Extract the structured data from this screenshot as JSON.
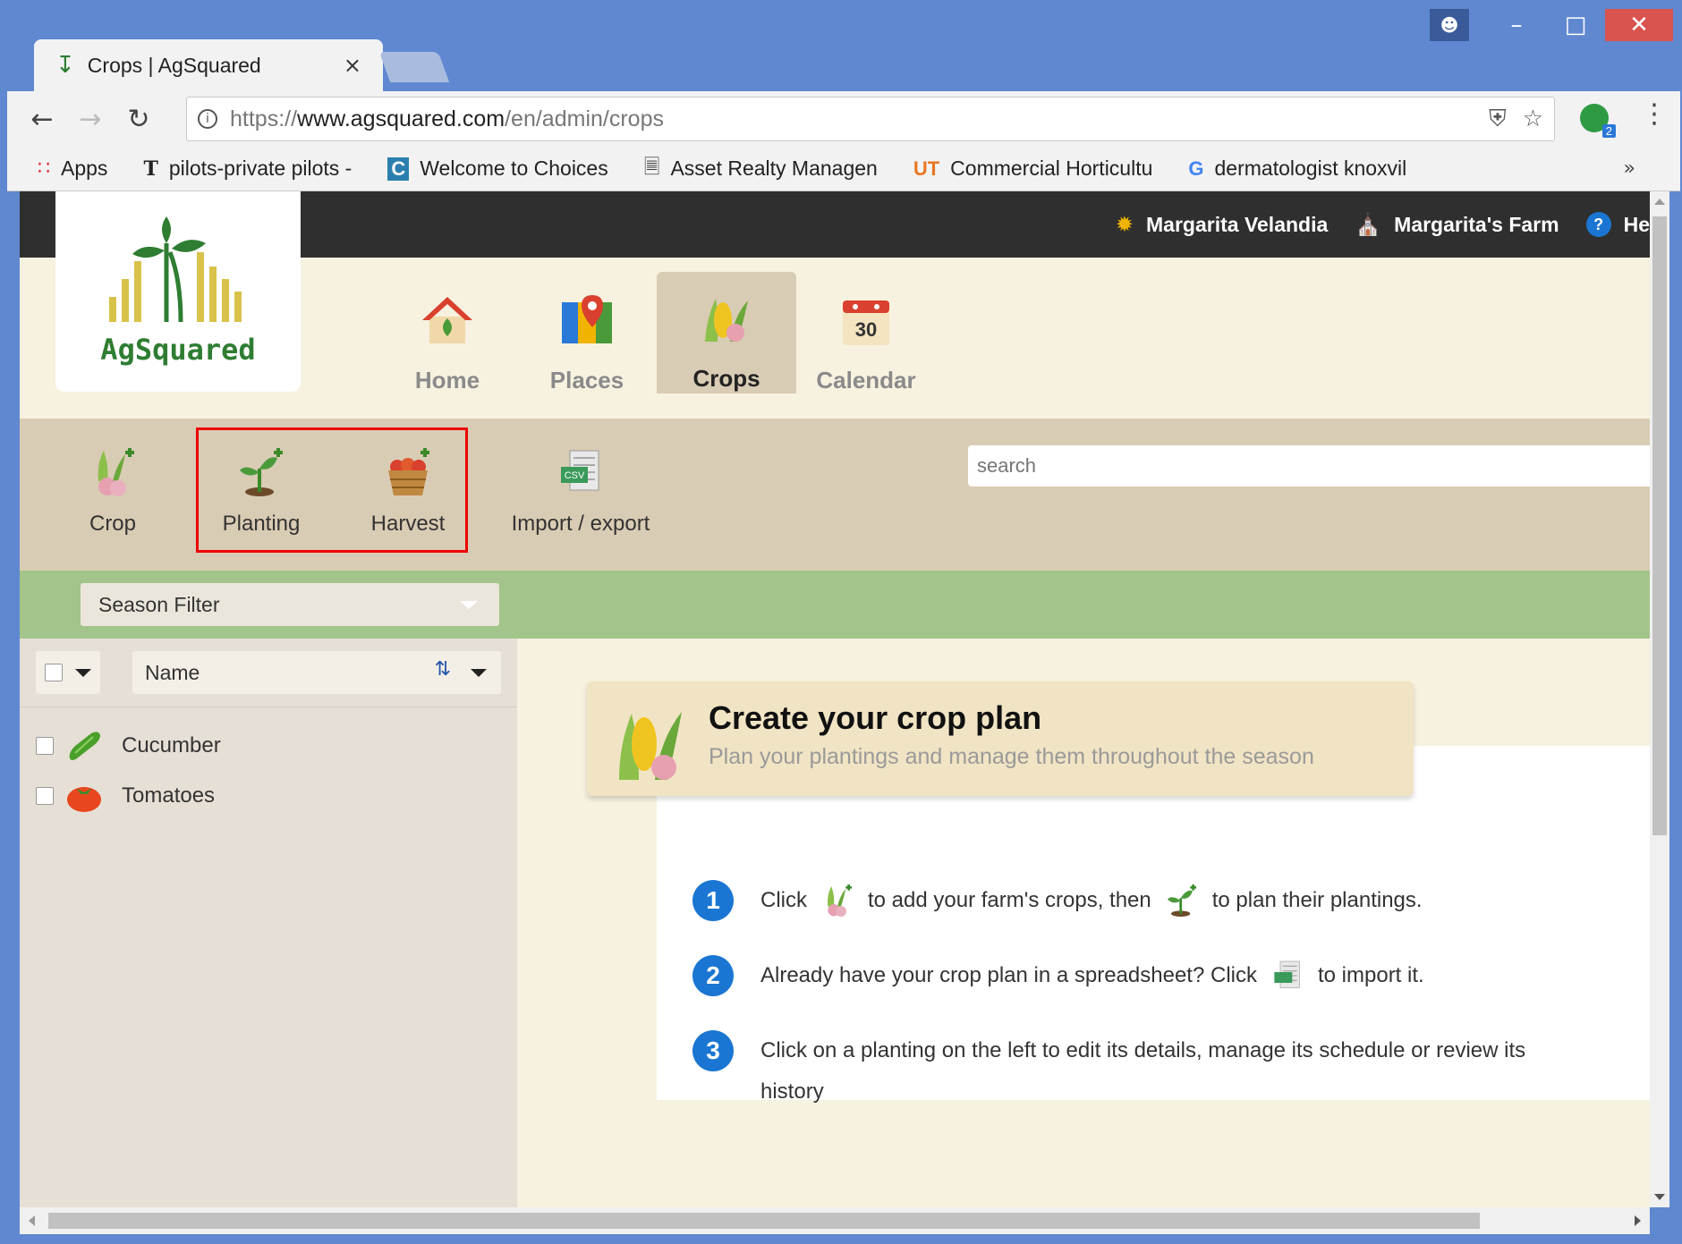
{
  "browser": {
    "tab_title": "Crops | AgSquared",
    "tab_close": "×",
    "url_prefix": "https://",
    "url_domain": "www.agsquared.com",
    "url_path": "/en/admin/crops",
    "extension_badge": "2"
  },
  "bookmarks": [
    {
      "icon": "apps-grid-icon",
      "label": "Apps"
    },
    {
      "icon": "nyt-icon",
      "label": "pilots-private pilots -"
    },
    {
      "icon": "choices-icon",
      "label": "Welcome to Choices"
    },
    {
      "icon": "page-icon",
      "label": "Asset Realty Managen"
    },
    {
      "icon": "ut-icon",
      "label": "Commercial Horticultu"
    },
    {
      "icon": "google-icon",
      "label": "dermatologist knoxvil"
    }
  ],
  "bookmarks_more": "»",
  "topbar": {
    "user_name": "Margarita Velandia",
    "farm_name": "Margarita's Farm",
    "help_label": "He"
  },
  "logo": {
    "text": "AgSquared"
  },
  "main_nav": [
    {
      "label": "Home",
      "icon": "home-icon",
      "active": false
    },
    {
      "label": "Places",
      "icon": "places-map-icon",
      "active": false
    },
    {
      "label": "Crops",
      "icon": "crops-icon",
      "active": true
    },
    {
      "label": "Calendar",
      "icon": "calendar-icon",
      "active": false
    }
  ],
  "calendar_day": "30",
  "sub_nav": [
    {
      "label": "Crop",
      "icon": "add-crop-icon"
    },
    {
      "label": "Planting",
      "icon": "add-planting-icon"
    },
    {
      "label": "Harvest",
      "icon": "add-harvest-icon"
    },
    {
      "label": "Import / export",
      "icon": "csv-icon"
    }
  ],
  "search": {
    "placeholder": "search"
  },
  "season_filter": {
    "label": "Season Filter"
  },
  "list": {
    "sort_label": "Name",
    "items": [
      {
        "name": "Cucumber",
        "icon": "cucumber-icon"
      },
      {
        "name": "Tomatoes",
        "icon": "tomato-icon"
      }
    ]
  },
  "hero": {
    "title": "Create your crop plan",
    "subtitle": "Plan your plantings and manage them throughout the season"
  },
  "steps": {
    "s1": {
      "num": "1",
      "a": "Click",
      "b": "to add your farm's crops, then",
      "c": "to plan their plantings."
    },
    "s2": {
      "num": "2",
      "a": "Already have your crop plan in a spreadsheet? Click",
      "b": "to import it."
    },
    "s3": {
      "num": "3",
      "a": "Click on a planting on the left to edit its details, manage its schedule or review its history"
    }
  },
  "colors": {
    "accent_blue": "#1a76d2",
    "topbar": "#2f2f2f",
    "subbar": "#d9ccb4",
    "green_bar": "#a3c48a",
    "highlight_red": "#e00000"
  }
}
